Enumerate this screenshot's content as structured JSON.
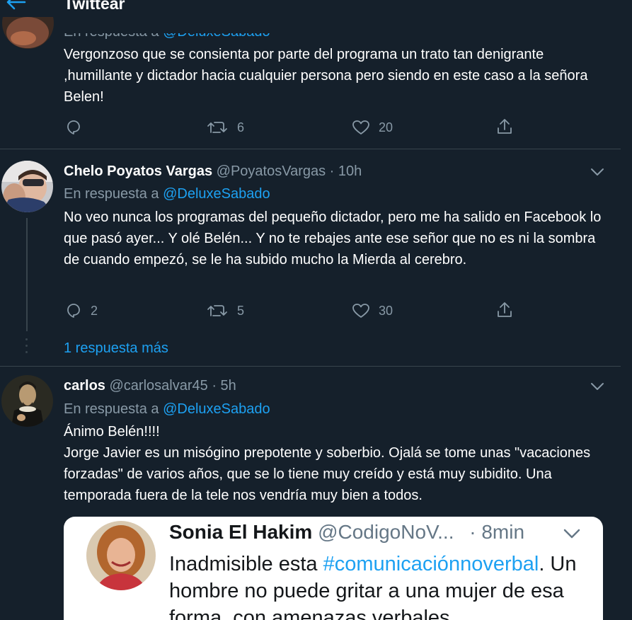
{
  "header": {
    "title": "Twittear",
    "back_icon": "arrow-left-icon"
  },
  "colors": {
    "background": "#15202b",
    "accent": "#1da1f2",
    "muted": "#8899a6",
    "border": "#38444d"
  },
  "tweets": [
    {
      "replying_prefix": "En respuesta a",
      "replying_to": "@DeluxeSabado",
      "text": "Vergonzoso que se consienta por parte del programa un trato tan denigrante ,humillante y dictador hacia cualquier persona pero siendo en este caso a la señora Belen!",
      "reply_count": "",
      "retweet_count": "6",
      "like_count": "20"
    },
    {
      "name": "Chelo Poyatos Vargas",
      "handle": "@PoyatosVargas",
      "dot": "·",
      "time": "10h",
      "replying_prefix": "En respuesta a",
      "replying_to": "@DeluxeSabado",
      "text": "No veo nunca los programas del pequeño dictador, pero me ha salido en Facebook lo que pasó ayer... Y olé Belén... Y no te rebajes ante ese señor que no es ni la sombra de cuando empezó, se le ha subido mucho la Mierda al cerebro.",
      "reply_count": "2",
      "retweet_count": "5",
      "like_count": "30"
    },
    {
      "name": "carlos",
      "handle": "@carlosalvar45",
      "dot": "·",
      "time": "5h",
      "replying_prefix": "En respuesta a",
      "replying_to": "@DeluxeSabado",
      "text_line1": "Ánimo Belén!!!!",
      "text_rest": "Jorge Javier es un misógino prepotente y soberbio. Ojalá se tome unas \"vacaciones forzadas\" de varios años, que se lo tiene muy creído y está muy subidito. Una temporada fuera de la tele nos vendría muy bien a todos."
    }
  ],
  "more_replies": "1 respuesta más",
  "embedded": {
    "name": "Sonia El Hakim",
    "handle": "@CodigoNoV...",
    "dot": "·",
    "time": "8min",
    "text_before": "Inadmisible esta ",
    "hashtag": "#comunicaciónnoverbal",
    "text_after": ". Un hombre no puede gritar a una mujer de esa forma, con amenazas verbales"
  }
}
